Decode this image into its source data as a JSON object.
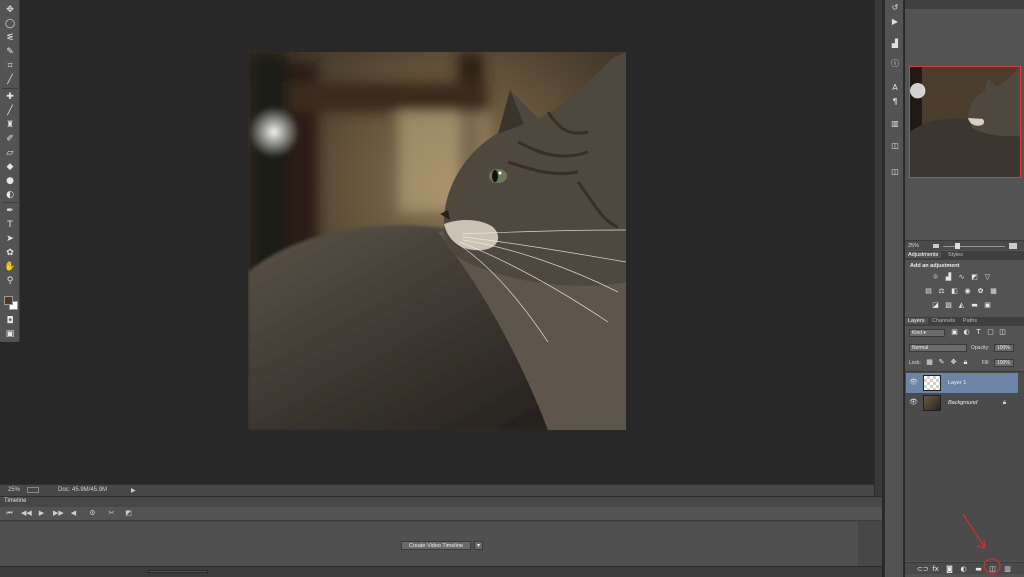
{
  "status_bar": {
    "zoom": "25%",
    "doc_info": "Doc: 45.9M/45.9M"
  },
  "timeline": {
    "tab_label": "Timeline",
    "create_button_label": "Create Video Timeline"
  },
  "navigator": {
    "zoom": "25%"
  },
  "adjustments": {
    "tabs": [
      "Adjustments",
      "Styles"
    ],
    "heading": "Add an adjustment"
  },
  "layers": {
    "tabs": [
      "Layers",
      "Channels",
      "Paths"
    ],
    "kind_filter": "Kind",
    "blend_mode": "Normal",
    "opacity_label": "Opacity:",
    "opacity_value": "100%",
    "lock_label": "Lock:",
    "fill_label": "Fill:",
    "fill_value": "100%",
    "items": [
      {
        "name": "Layer 1",
        "selected": true
      },
      {
        "name": "Background",
        "selected": false
      }
    ]
  },
  "colors": {
    "selected_layer": "#6c84a6",
    "annotation_red": "#d32f2f"
  }
}
